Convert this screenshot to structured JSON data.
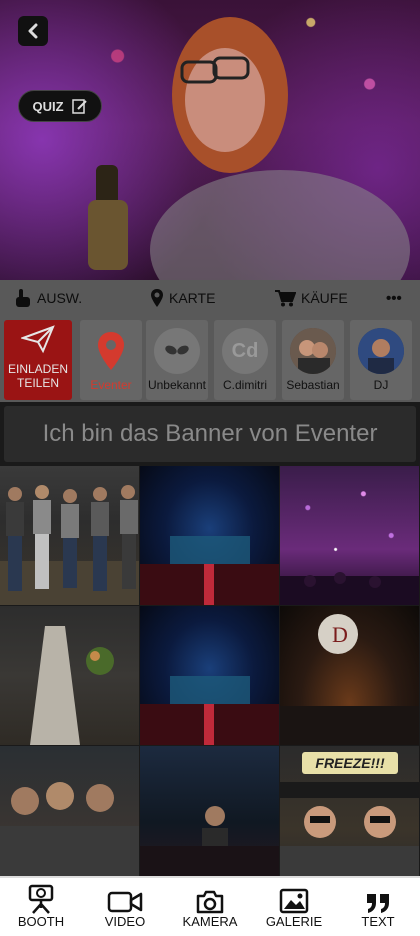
{
  "hero": {
    "quiz_label": "QUIZ"
  },
  "action_bar": {
    "select_label": "AUSW.",
    "map_label": "KARTE",
    "buy_label": "KÄUFE",
    "more_label": "•••"
  },
  "invite": {
    "line1": "EINLADEN",
    "line2": "TEILEN"
  },
  "members": [
    {
      "name": "Eventer"
    },
    {
      "name": "Unbekannt"
    },
    {
      "name": "C.dimitri",
      "initials": "Cd"
    },
    {
      "name": "Sebastian"
    },
    {
      "name": "DJ"
    }
  ],
  "banner": {
    "text": "Ich bin das Banner von Eventer"
  },
  "freeze_text": "FREEZE!!!",
  "balloon_letter": "D",
  "bottom_nav": [
    {
      "label": "BOOTH",
      "icon": "booth-camera-icon"
    },
    {
      "label": "VIDEO",
      "icon": "video-camera-icon"
    },
    {
      "label": "KAMERA",
      "icon": "camera-icon"
    },
    {
      "label": "GALERIE",
      "icon": "gallery-icon"
    },
    {
      "label": "TEXT",
      "icon": "quote-icon"
    }
  ],
  "colors": {
    "invite_red": "#9a1414",
    "eventer_red": "#d43a2e",
    "bar_grey": "#595959",
    "banner_bg": "#2b2b2b"
  }
}
